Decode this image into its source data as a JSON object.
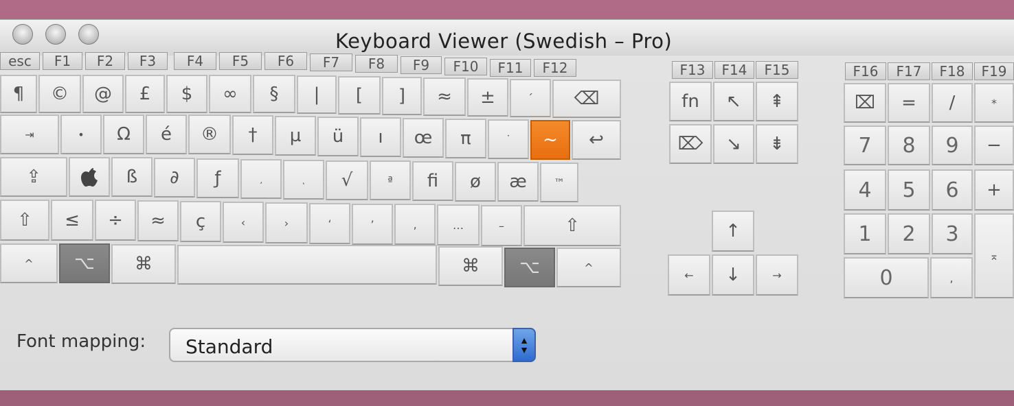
{
  "window": {
    "title": "Keyboard Viewer (Swedish – Pro)"
  },
  "function_row_main": [
    "esc",
    "F1",
    "F2",
    "F3",
    "F4",
    "F5",
    "F6",
    "F7",
    "F8",
    "F9",
    "F10",
    "F11",
    "F12"
  ],
  "function_row_mid": [
    "F13",
    "F14",
    "F15"
  ],
  "function_row_keypad": [
    "F16",
    "F17",
    "F18",
    "F19"
  ],
  "rows": {
    "row1": [
      "¶",
      "©",
      "@",
      "£",
      "$",
      "∞",
      "§",
      "|",
      "[",
      "]",
      "≈",
      "±",
      "´",
      "⌫"
    ],
    "row2": [
      "⇥",
      "•",
      "Ω",
      "é",
      "®",
      "†",
      "µ",
      "ü",
      "ı",
      "œ",
      "π",
      "˙",
      "~",
      "↩"
    ],
    "row3": [
      "⇪",
      "",
      "ß",
      "∂",
      "ƒ",
      "¸",
      "˛",
      "√",
      "ª",
      "ﬁ",
      "ø",
      "æ",
      "™"
    ],
    "row4": [
      "⇧",
      "≤",
      "÷",
      "≈",
      "ç",
      "‹",
      "›",
      "‘",
      "’",
      "‚",
      "…",
      "–",
      "⇧"
    ],
    "row5": [
      "^",
      "⌥",
      "⌘",
      "",
      "⌘",
      "⌥",
      "^"
    ]
  },
  "nav_cluster": {
    "row1": [
      "fn",
      "↖",
      "⇞"
    ],
    "row2": [
      "⌦",
      "↘",
      "⇟"
    ],
    "arrows": [
      "↑",
      "←",
      "↓",
      "→"
    ]
  },
  "keypad": {
    "row1": [
      "⌧",
      "=",
      "/",
      "*"
    ],
    "row2": [
      "7",
      "8",
      "9",
      "−"
    ],
    "row3": [
      "4",
      "5",
      "6",
      "+"
    ],
    "row4": [
      "1",
      "2",
      "3",
      "⌅"
    ],
    "row5": [
      "0",
      ","
    ]
  },
  "font_mapping": {
    "label": "Font mapping:",
    "value": "Standard"
  },
  "colors": {
    "highlight": "#f07a1c",
    "modifier_dark": "#7f7f7f"
  }
}
